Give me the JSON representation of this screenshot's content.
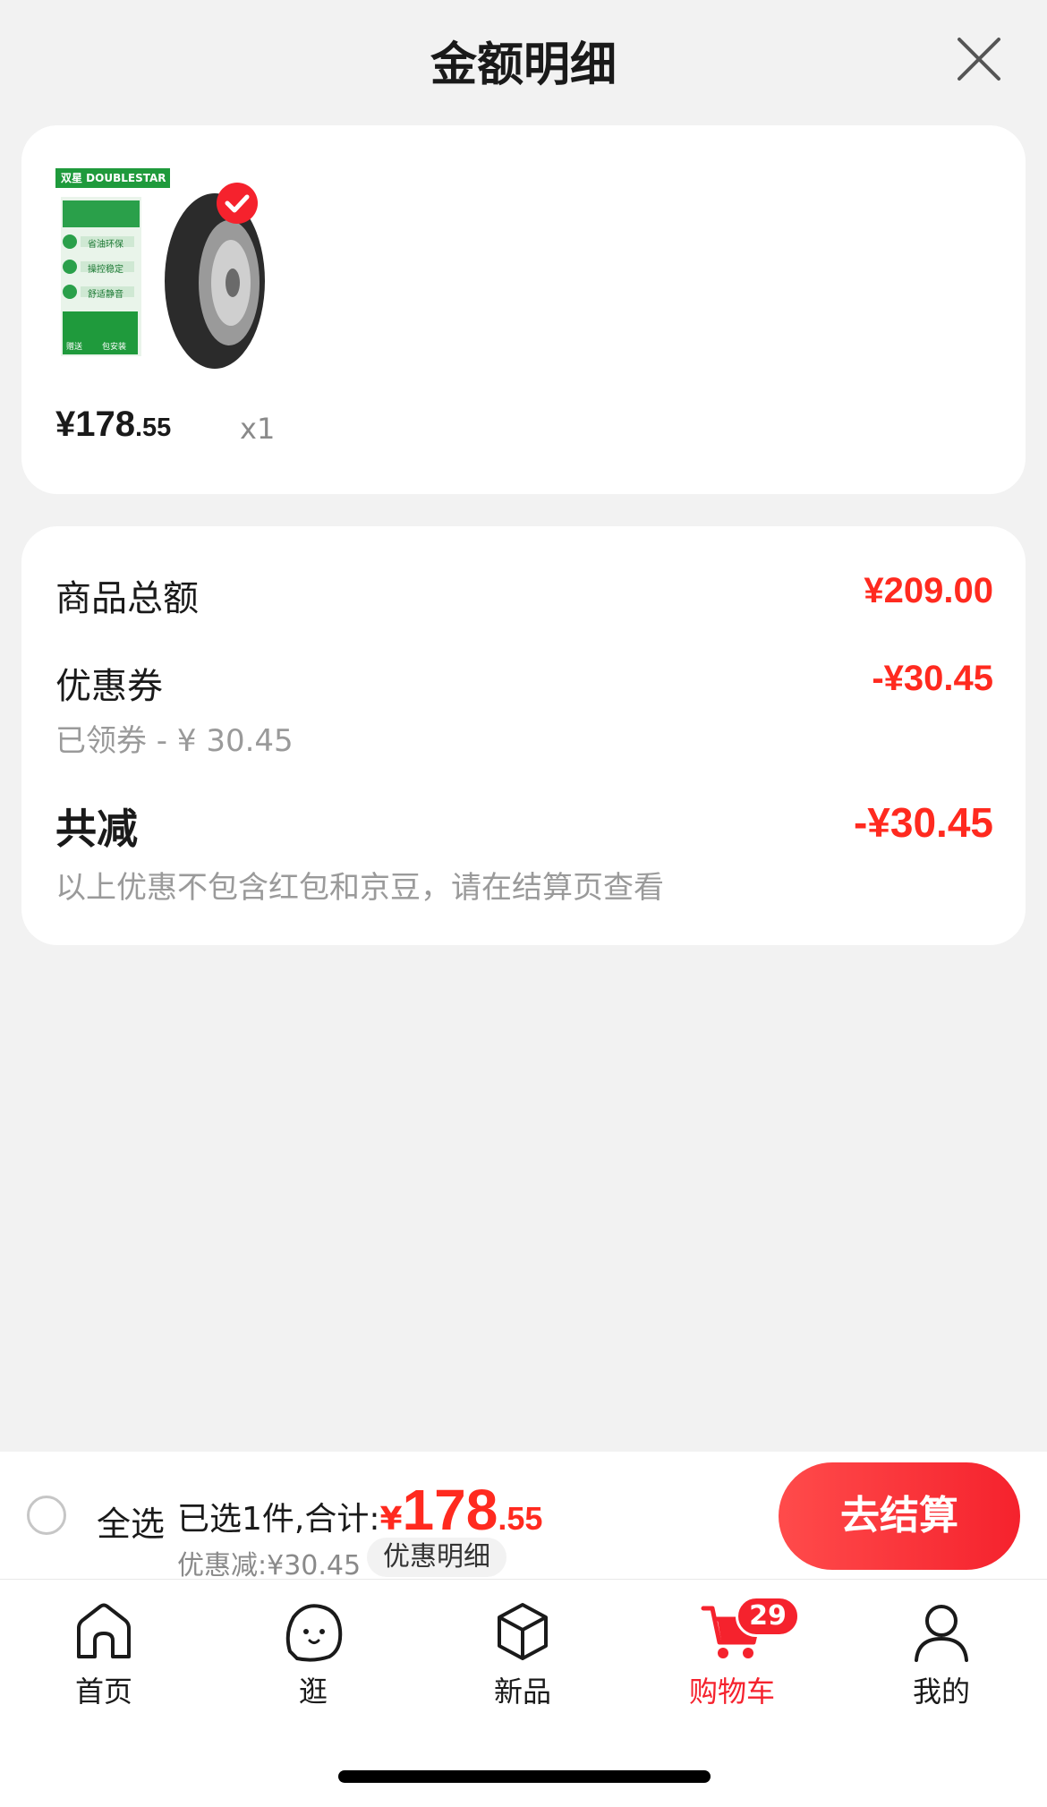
{
  "header": {
    "title": "金额明细"
  },
  "item": {
    "brand_text": "双星 DOUBLESTAR",
    "feature_1": "省油环保",
    "feature_2": "操控稳定",
    "feature_3": "舒适静音",
    "badge_text_1": "包安装",
    "badge_text_2": "赠送",
    "price_int": "¥178",
    "price_dec": ".55",
    "quantity": "x1"
  },
  "details": {
    "goods_total_label": "商品总额",
    "goods_total_value": "¥209.00",
    "coupon_label": "优惠券",
    "coupon_value": "-¥30.45",
    "coupon_sub": "已领券 - ¥ 30.45",
    "total_off_label": "共减",
    "total_off_value": "-¥30.45",
    "note": "以上优惠不包含红包和京豆，请在结算页查看"
  },
  "checkout": {
    "select_all": "全选",
    "selected_prefix": "已选1件,合计:",
    "currency": "¥",
    "total_int": "178",
    "total_dec": ".55",
    "discount": "优惠减:¥30.45",
    "detail_button": "优惠明细",
    "go_button": "去结算"
  },
  "tabbar": {
    "items": [
      {
        "label": "首页"
      },
      {
        "label": "逛"
      },
      {
        "label": "新品"
      },
      {
        "label": "购物车",
        "badge": "29"
      },
      {
        "label": "我的"
      }
    ]
  },
  "colors": {
    "accent": "#f5222d",
    "price_red": "#ff2a1f"
  }
}
